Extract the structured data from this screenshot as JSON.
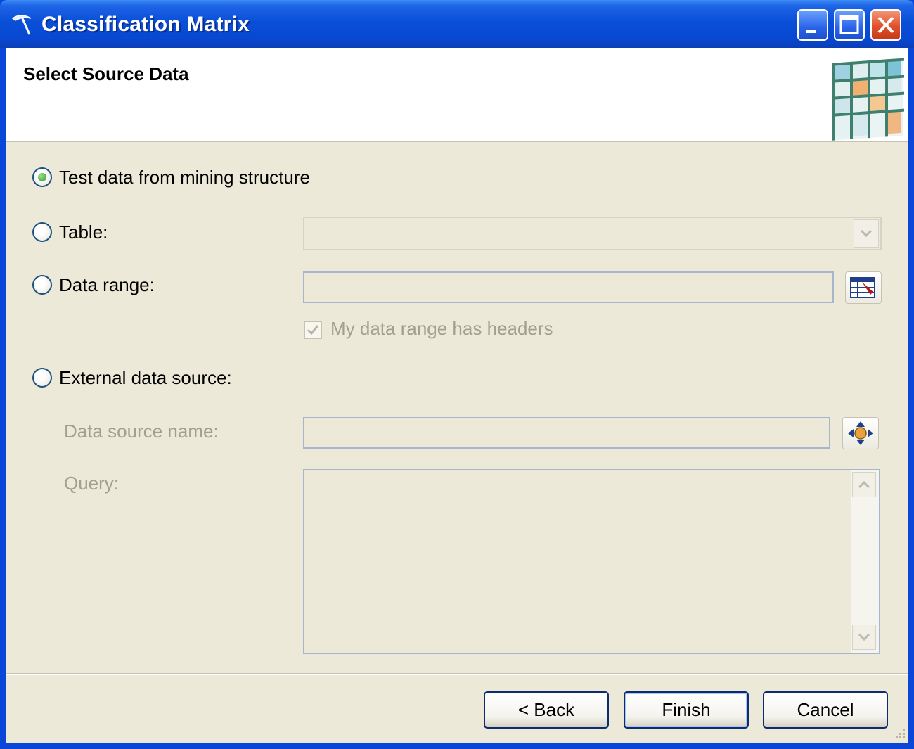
{
  "window": {
    "title": "Classification Matrix",
    "title_color": "#ffffff",
    "titlebar_color": "#0a4fd8"
  },
  "header": {
    "title": "Select Source Data"
  },
  "options": {
    "test_data": {
      "label": "Test data from mining structure",
      "selected": true
    },
    "table": {
      "label": "Table:",
      "selected": false,
      "value": ""
    },
    "data_range": {
      "label": "Data range:",
      "selected": false,
      "value": ""
    },
    "headers_checkbox": {
      "label": "My data range has headers",
      "checked": true,
      "enabled": false
    },
    "external": {
      "label": "External data source:",
      "selected": false
    }
  },
  "external_source": {
    "data_source_name_label": "Data source name:",
    "data_source_name_value": "",
    "query_label": "Query:",
    "query_value": ""
  },
  "buttons": {
    "back": "< Back",
    "finish": "Finish",
    "cancel": "Cancel"
  },
  "colors": {
    "dialog_bg": "#ece9d8",
    "disabled_text": "#a19f92",
    "radio_selected": "#2a9a20"
  },
  "icons": {
    "app": "pickaxe-icon",
    "range_picker": "select-range-icon",
    "data_source": "data-source-icon",
    "header_graphic": "matrix-grid-icon"
  }
}
